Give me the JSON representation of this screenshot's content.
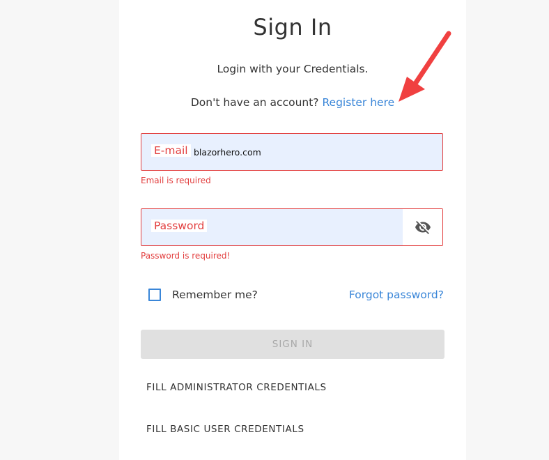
{
  "page": {
    "title": "Sign In",
    "subtitle": "Login with your Credentials."
  },
  "register": {
    "prompt": "Don't have an account?",
    "link_label": "Register here"
  },
  "email_field": {
    "label": "E-mail",
    "value": "blazorhero.com",
    "error": "Email is required"
  },
  "password_field": {
    "label": "Password",
    "value": "",
    "error": "Password is required!",
    "toggle_icon": "eye-off-icon"
  },
  "remember": {
    "label": "Remember me?",
    "checked": false
  },
  "forgot": {
    "label": "Forgot password?"
  },
  "actions": {
    "signin_label": "SIGN IN",
    "admin_label": "FILL ADMINISTRATOR CREDENTIALS",
    "basic_label": "FILL BASIC USER CREDENTIALS"
  },
  "colors": {
    "error": "#e23e3e",
    "link": "#3a86d8",
    "field_fill": "#e8f0fe",
    "annotation_arrow": "#f04040"
  }
}
